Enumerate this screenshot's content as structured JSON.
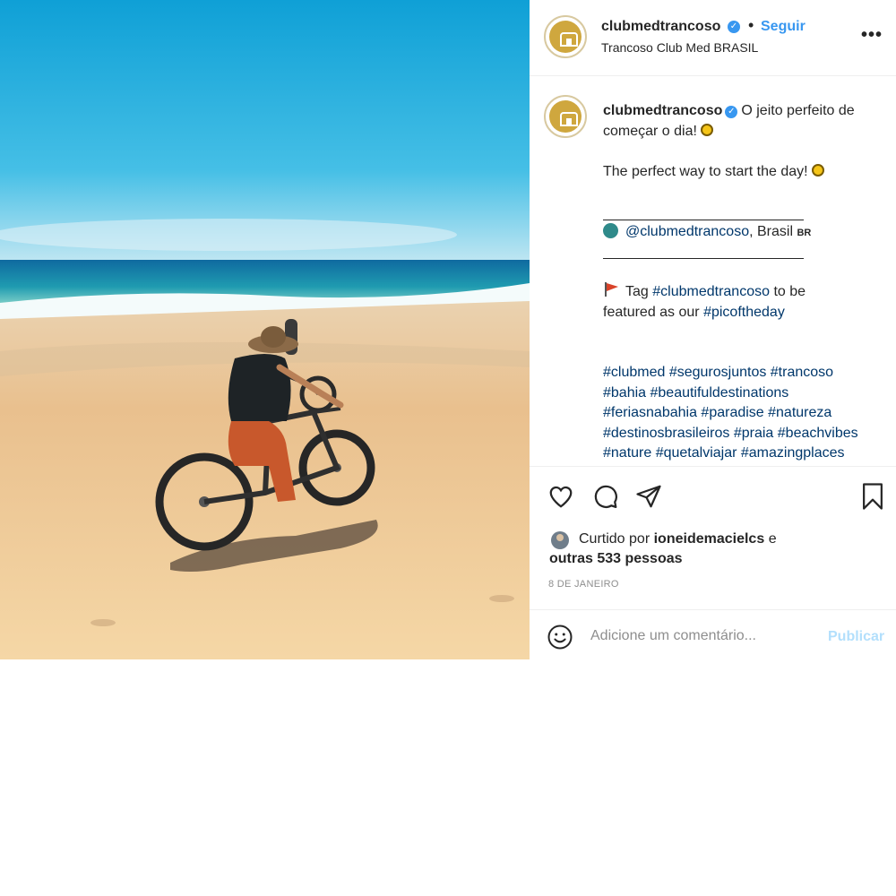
{
  "header": {
    "username": "clubmedtrancoso",
    "separator": "•",
    "follow_label": "Seguir",
    "location": "Trancoso Club Med BRASIL",
    "more_label": "•••"
  },
  "caption": {
    "username": "clubmedtrancoso",
    "line1_text": "O jeito perfeito de",
    "line2_text": "começar o dia!",
    "english_text": "The perfect way to start the day!",
    "mention": "@clubmedtrancoso",
    "mention_suffix": ", Brasil",
    "country_code": "BR",
    "tag_prefix": "Tag",
    "tag_handle": "#clubmedtrancoso",
    "tag_suffix": "to be",
    "featured_prefix": "featured as our",
    "featured_tag": "#picoftheday",
    "hashtag_lines": [
      "#clubmed #segurosjuntos #trancoso",
      "#bahia #beautifuldestinations",
      "#feriasnabahia #paradise #natureza",
      "#destinosbrasileiros #praia #beachvibes",
      "#nature #quetalviajar #amazingplaces"
    ]
  },
  "likes": {
    "prefix": "Curtido por",
    "liker": "ioneidemacielcs",
    "conjunction": "e",
    "others": "outras 533 pessoas"
  },
  "date": "8 DE JANEIRO",
  "comment": {
    "placeholder": "Adicione um comentário...",
    "publish_label": "Publicar"
  },
  "icons": {
    "verified": "verified-badge-icon",
    "sun": "sun-emoji-icon",
    "globe": "globe-emoji-icon",
    "flag": "triangular-flag-emoji-icon",
    "like": "heart-icon",
    "comment": "comment-bubble-icon",
    "share": "paper-plane-icon",
    "save": "bookmark-icon",
    "emoji": "smiley-icon"
  },
  "colors": {
    "link_blue": "#3897f0",
    "hashtag": "#00376b",
    "muted": "#8e8e8e",
    "publish_disabled": "#b2dffc",
    "brand_gold": "#cfa73e"
  }
}
